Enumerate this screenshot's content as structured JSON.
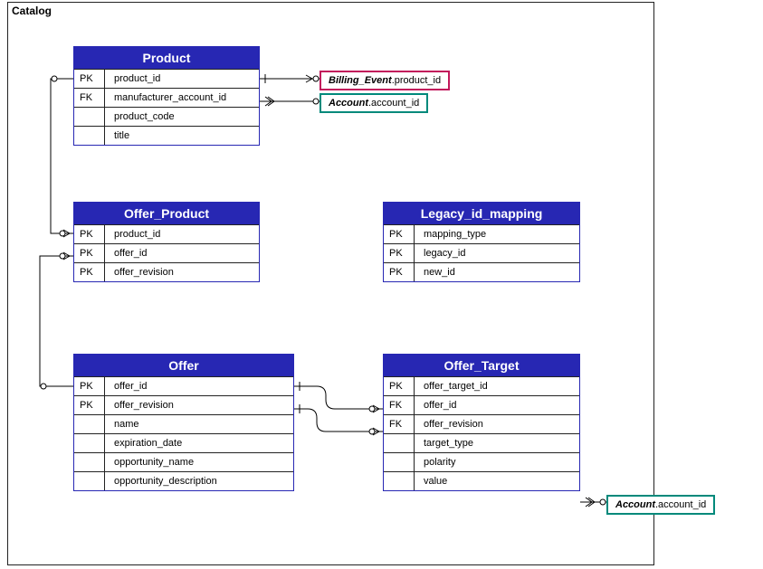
{
  "package": {
    "title": "Catalog"
  },
  "entities": {
    "product": {
      "title": "Product",
      "rows": [
        {
          "key": "PK",
          "field": "product_id"
        },
        {
          "key": "FK",
          "field": "manufacturer_account_id"
        },
        {
          "key": "",
          "field": "product_code"
        },
        {
          "key": "",
          "field": "title"
        }
      ]
    },
    "offer_product": {
      "title": "Offer_Product",
      "rows": [
        {
          "key": "PK",
          "field": "product_id"
        },
        {
          "key": "PK",
          "field": "offer_id"
        },
        {
          "key": "PK",
          "field": "offer_revision"
        }
      ]
    },
    "legacy_id_mapping": {
      "title": "Legacy_id_mapping",
      "rows": [
        {
          "key": "PK",
          "field": "mapping_type"
        },
        {
          "key": "PK",
          "field": "legacy_id"
        },
        {
          "key": "PK",
          "field": "new_id"
        }
      ]
    },
    "offer": {
      "title": "Offer",
      "rows": [
        {
          "key": "PK",
          "field": "offer_id"
        },
        {
          "key": "PK",
          "field": "offer_revision"
        },
        {
          "key": "",
          "field": "name"
        },
        {
          "key": "",
          "field": "expiration_date"
        },
        {
          "key": "",
          "field": "opportunity_name"
        },
        {
          "key": "",
          "field": "opportunity_description"
        }
      ]
    },
    "offer_target": {
      "title": "Offer_Target",
      "rows": [
        {
          "key": "PK",
          "field": "offer_target_id"
        },
        {
          "key": "FK",
          "field": "offer_id"
        },
        {
          "key": "FK",
          "field": "offer_revision"
        },
        {
          "key": "",
          "field": "target_type"
        },
        {
          "key": "",
          "field": "polarity"
        },
        {
          "key": "",
          "field": "value"
        }
      ]
    }
  },
  "ext_refs": {
    "billing_event": {
      "entity": "Billing_Event",
      "field": ".product_id",
      "color": "#c2185b"
    },
    "account_top": {
      "entity": "Account",
      "field": ".account_id",
      "color": "#00897b"
    },
    "account_bottom": {
      "entity": "Account",
      "field": ".account_id",
      "color": "#00897b"
    }
  },
  "chart_data": {
    "type": "er-diagram",
    "package": "Catalog",
    "tables": [
      {
        "name": "Product",
        "columns": [
          {
            "name": "product_id",
            "pk": true
          },
          {
            "name": "manufacturer_account_id",
            "fk": true
          },
          {
            "name": "product_code"
          },
          {
            "name": "title"
          }
        ]
      },
      {
        "name": "Offer_Product",
        "columns": [
          {
            "name": "product_id",
            "pk": true
          },
          {
            "name": "offer_id",
            "pk": true
          },
          {
            "name": "offer_revision",
            "pk": true
          }
        ]
      },
      {
        "name": "Legacy_id_mapping",
        "columns": [
          {
            "name": "mapping_type",
            "pk": true
          },
          {
            "name": "legacy_id",
            "pk": true
          },
          {
            "name": "new_id",
            "pk": true
          }
        ]
      },
      {
        "name": "Offer",
        "columns": [
          {
            "name": "offer_id",
            "pk": true
          },
          {
            "name": "offer_revision",
            "pk": true
          },
          {
            "name": "name"
          },
          {
            "name": "expiration_date"
          },
          {
            "name": "opportunity_name"
          },
          {
            "name": "opportunity_description"
          }
        ]
      },
      {
        "name": "Offer_Target",
        "columns": [
          {
            "name": "offer_target_id",
            "pk": true
          },
          {
            "name": "offer_id",
            "fk": true
          },
          {
            "name": "offer_revision",
            "fk": true
          },
          {
            "name": "target_type"
          },
          {
            "name": "polarity"
          },
          {
            "name": "value"
          }
        ]
      }
    ],
    "relationships": [
      {
        "from": "Product.product_id",
        "to": "Offer_Product.product_id"
      },
      {
        "from": "Offer.offer_id",
        "to": "Offer_Product.offer_id"
      },
      {
        "from": "Offer.offer_id",
        "to": "Offer_Target.offer_id"
      },
      {
        "from": "Offer.offer_revision",
        "to": "Offer_Target.offer_revision"
      },
      {
        "from": "Product.product_id",
        "to": "Billing_Event.product_id",
        "external": true
      },
      {
        "from": "Product.manufacturer_account_id",
        "to": "Account.account_id",
        "external": true
      },
      {
        "from": "Offer_Target.value",
        "to": "Account.account_id",
        "external": true
      }
    ]
  }
}
